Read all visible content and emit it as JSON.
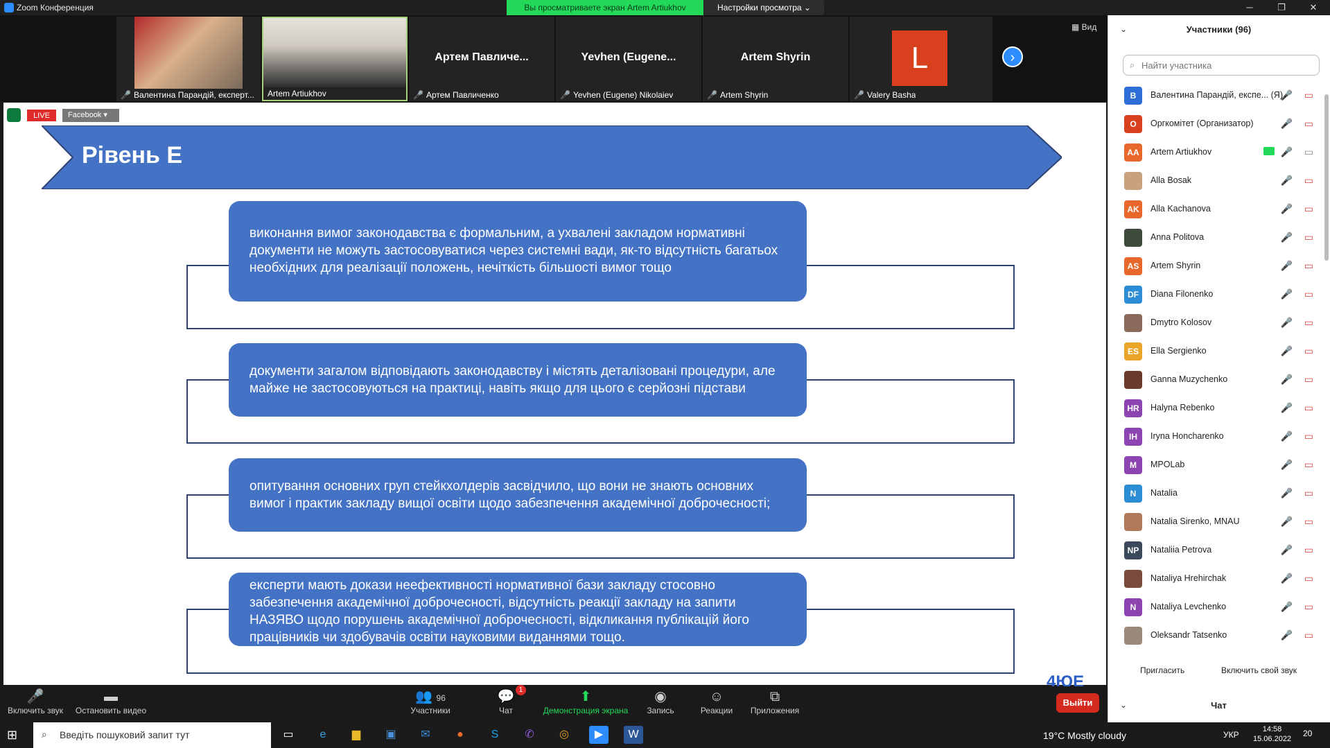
{
  "window": {
    "title": "Zoom Конференция",
    "share_banner": "Вы просматриваете экран Artem Artiukhov",
    "view_options": "Настройки просмотра ⌄",
    "view_button": "▦ Вид"
  },
  "videos": [
    {
      "name": "Валентина Парандій, експерт..."
    },
    {
      "name": "Artem Artiukhov"
    },
    {
      "name": "Артем Павличенко",
      "display": "Артем Павличе..."
    },
    {
      "name": "Yevhen (Eugene) Nikolaiev",
      "display": "Yevhen (Eugene..."
    },
    {
      "name": "Artem Shyrin",
      "display": "Artem Shyrin"
    },
    {
      "name": "Valery Basha",
      "initial": "L"
    }
  ],
  "shared_screen": {
    "live_label": "LIVE",
    "platform_label": "Facebook ▾",
    "slide_title": "Рівень Е",
    "cards": [
      "виконання вимог законодавства є формальним, а ухвалені закладом нормативні документи не можуть застосовуватися через системні вади, як-то відсутність багатьох необхідних для реалізації положень, нечіткість більшості вимог тощо",
      "документи загалом відповідають законодавству і містять деталізовані процедури, але майже не застосовуються на практиці, навіть якщо для цього є серйозні підстави",
      "опитування основних груп стейкхолдерів засвідчило, що вони не знають основних вимог і практик закладу вищої освіти щодо забезпечення академічної доброчесності;",
      "експерти мають докази неефективності нормативної бази закладу стосовно забезпечення академічної доброчесності, відсутність реакції закладу на запити НАЗЯВО щодо порушень академічної доброчесності, відкликання публікацій його працівників чи здобувачів освіти науковими виданнями тощо."
    ],
    "brand": "4ЮЕ"
  },
  "toolbar": {
    "unmute": "Включить звук",
    "stop_video": "Остановить видео",
    "participants": "Участники",
    "participants_count": "96",
    "chat": "Чат",
    "chat_badge": "1",
    "share_screen": "Демонстрация экрана",
    "record": "Запись",
    "reactions": "Реакции",
    "apps": "Приложения",
    "leave": "Выйти"
  },
  "panel": {
    "title": "Участники (96)",
    "search_placeholder": "Найти участника",
    "participants": [
      {
        "initials": "В",
        "name": "Валентина Парандій, експе... (Я)",
        "color": "#2d6fd6"
      },
      {
        "initials": "О",
        "name": "Оргкомітет (Организатор)",
        "color": "#d9411e"
      },
      {
        "initials": "AA",
        "name": "Artem Artiukhov",
        "color": "#e8672a",
        "sharing": true
      },
      {
        "initials": "",
        "name": "Alla Bosak",
        "color": "#c7a27c"
      },
      {
        "initials": "AK",
        "name": "Alla Kachanova",
        "color": "#e8672a"
      },
      {
        "initials": "",
        "name": "Anna Politova",
        "color": "#3e4a3c"
      },
      {
        "initials": "AS",
        "name": "Artem Shyrin",
        "color": "#e8672a"
      },
      {
        "initials": "DF",
        "name": "Diana Filonenko",
        "color": "#2d8cd6"
      },
      {
        "initials": "",
        "name": "Dmytro Kolosov",
        "color": "#8a6a5a"
      },
      {
        "initials": "ES",
        "name": "Ella Sergienko",
        "color": "#e9a52a"
      },
      {
        "initials": "",
        "name": "Ganna Muzychenko",
        "color": "#6b3a2a"
      },
      {
        "initials": "HR",
        "name": "Halyna Rebenko",
        "color": "#8b44b0"
      },
      {
        "initials": "IH",
        "name": "Iryna Honcharenko",
        "color": "#8b44b0"
      },
      {
        "initials": "M",
        "name": "MPOLab",
        "color": "#8b44b0"
      },
      {
        "initials": "N",
        "name": "Natalia",
        "color": "#2d8cd6"
      },
      {
        "initials": "",
        "name": "Natalia Sirenko, MNAU",
        "color": "#b07a5a"
      },
      {
        "initials": "NP",
        "name": "Nataliia Petrova",
        "color": "#3a4a5a"
      },
      {
        "initials": "",
        "name": "Nataliya Hrehirchak",
        "color": "#7a4a3a"
      },
      {
        "initials": "N",
        "name": "Nataliya Levchenko",
        "color": "#8b44b0"
      },
      {
        "initials": "",
        "name": "Oleksandr Tatsenko",
        "color": "#9a8a7a"
      }
    ],
    "invite": "Пригласить",
    "unmute_me": "Включить свой звук",
    "chat_header": "Чат"
  },
  "taskbar": {
    "search_placeholder": "Введіть пошуковий запит тут",
    "weather": "19°C  Mostly cloudy",
    "lang": "УКР",
    "time": "14:58",
    "date": "15.06.2022",
    "notifications": "20"
  }
}
